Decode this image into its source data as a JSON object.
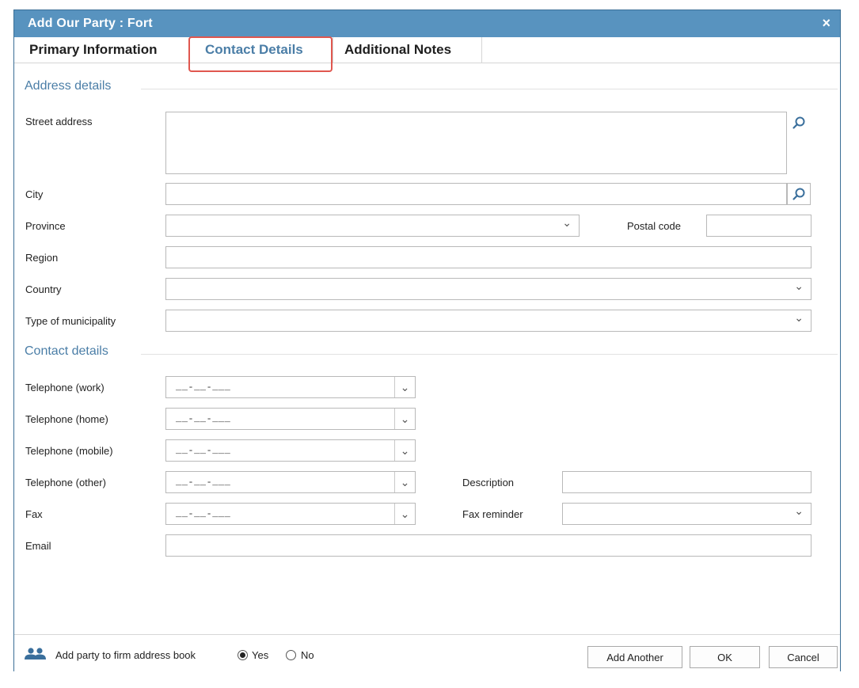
{
  "window": {
    "title": "Add Our Party : Fort",
    "close_glyph": "×"
  },
  "tabs": [
    {
      "label": "Primary Information"
    },
    {
      "label": "Contact Details"
    },
    {
      "label": "Additional Notes"
    }
  ],
  "address": {
    "heading": "Address details",
    "street_label": "Street address",
    "city_label": "City",
    "province_label": "Province",
    "postal_label": "Postal code",
    "region_label": "Region",
    "country_label": "Country",
    "municipality_label": "Type of municipality"
  },
  "contact": {
    "heading": "Contact details",
    "tel_work_label": "Telephone (work)",
    "tel_home_label": "Telephone (home)",
    "tel_mobile_label": "Telephone (mobile)",
    "tel_other_label": "Telephone (other)",
    "fax_label": "Fax",
    "email_label": "Email",
    "description_label": "Description",
    "fax_reminder_label": "Fax reminder",
    "phone_mask": "__-__-___"
  },
  "footer": {
    "add_label": "Add party to firm address book",
    "yes": "Yes",
    "no": "No",
    "add_another": "Add Another",
    "ok": "OK",
    "cancel": "Cancel"
  },
  "colors": {
    "titlebar": "#5893bf",
    "accent_text": "#4b7ea7",
    "highlight": "#e0574f"
  }
}
